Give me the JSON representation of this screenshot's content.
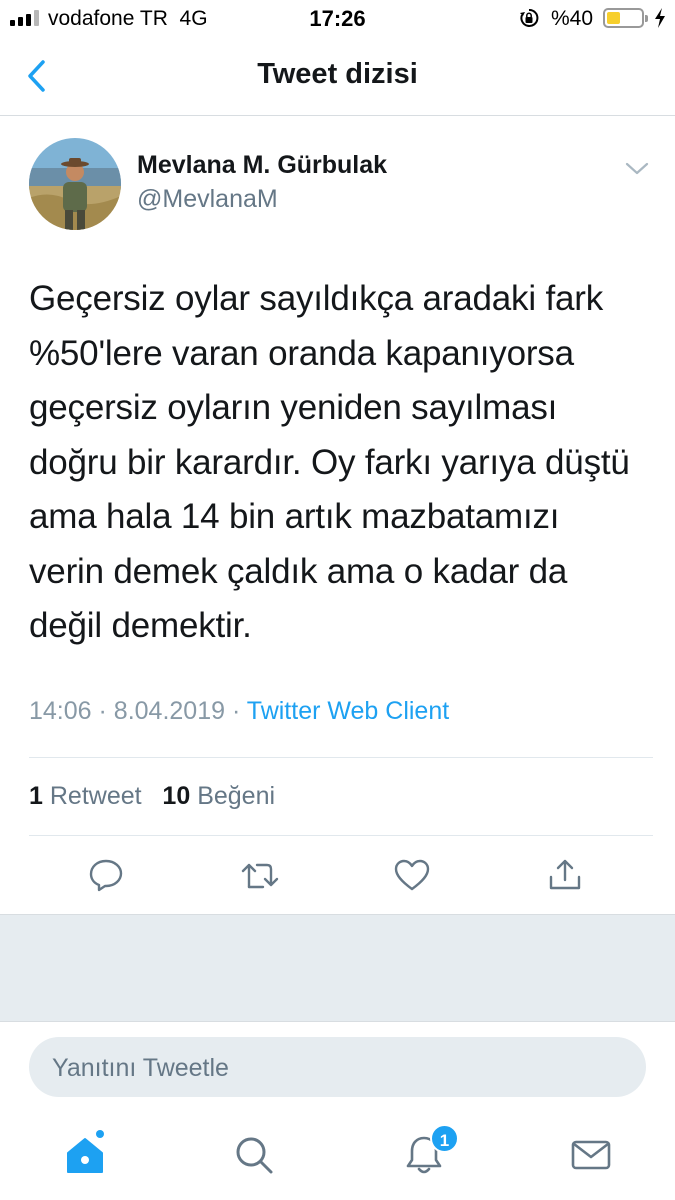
{
  "status_bar": {
    "carrier": "vodafone TR",
    "network": "4G",
    "time": "17:26",
    "battery": "%40",
    "battery_level": 0.4,
    "icons": [
      "signal-icon",
      "orientation-lock-icon",
      "battery-icon",
      "charging-icon"
    ]
  },
  "nav": {
    "title": "Tweet dizisi",
    "back_icon": "chevron-left-icon"
  },
  "tweet": {
    "author_name": "Mevlana M. Gürbulak",
    "author_handle": "@MevlanaM",
    "text_lines": [
      "Geçersiz oylar sayıldıkça aradaki fark",
      "%50'lere varan oranda kapanıyorsa",
      "geçersiz oyların yeniden sayılması",
      "doğru bir karardır. Oy farkı yarıya düştü",
      "ama hala 14 bin artık mazbatamızı",
      "verin demek çaldık ama o kadar da",
      "değil demektir."
    ],
    "time": "14:06",
    "date": "8.04.2019",
    "separator": "·",
    "source": "Twitter Web Client",
    "retweet_count": "1",
    "retweet_label": "Retweet",
    "like_count": "10",
    "like_label": "Beğeni"
  },
  "actions": [
    "reply-icon",
    "retweet-icon",
    "like-icon",
    "share-icon"
  ],
  "reply": {
    "placeholder": "Yanıtını Tweetle"
  },
  "tab_bar": {
    "items": [
      "home-icon",
      "search-icon",
      "notifications-icon",
      "messages-icon"
    ],
    "notifications_badge": "1"
  },
  "colors": {
    "accent": "#1da1f2",
    "text": "#14171a",
    "secondary": "#657786",
    "muted": "#8899a6",
    "background_gray": "#e6ecf0"
  }
}
